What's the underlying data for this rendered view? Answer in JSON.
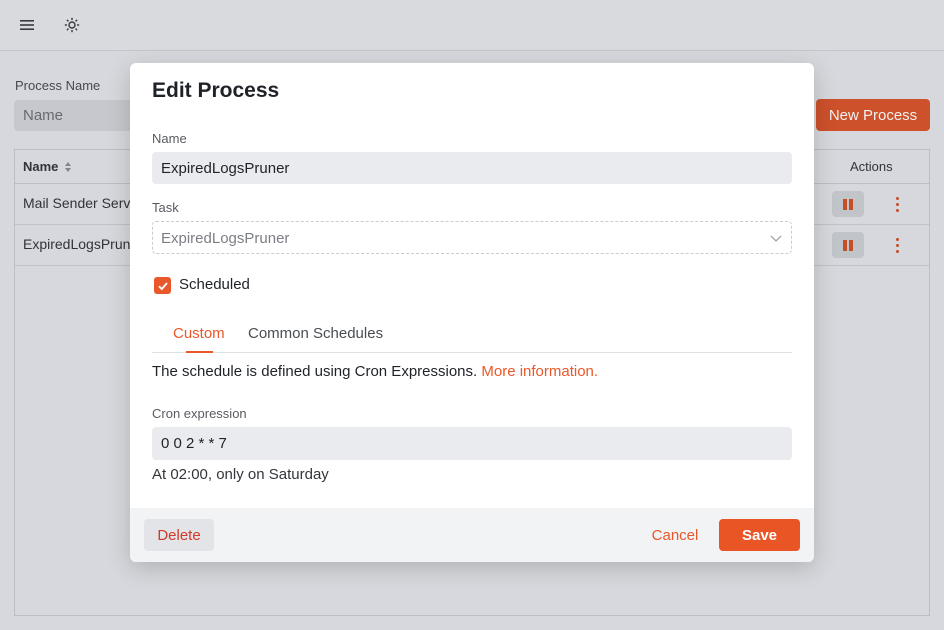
{
  "header": {
    "menu_icon": "hamburger-icon",
    "theme_icon": "sun-icon"
  },
  "filter": {
    "label": "Process Name",
    "placeholder": "Name"
  },
  "new_process_label": "New Process",
  "table": {
    "col_name": "Name",
    "col_actions": "Actions",
    "rows": [
      {
        "name": "Mail Sender Serv"
      },
      {
        "name": "ExpiredLogsPrun"
      }
    ]
  },
  "modal": {
    "title": "Edit Process",
    "name_label": "Name",
    "name_value": "ExpiredLogsPruner",
    "task_label": "Task",
    "task_value": "ExpiredLogsPruner",
    "scheduled_label": "Scheduled",
    "scheduled_checked": true,
    "tabs": [
      {
        "label": "Custom",
        "active": true
      },
      {
        "label": "Common Schedules",
        "active": false
      }
    ],
    "desc_text": "The schedule is defined using Cron Expressions. ",
    "desc_link": "More information.",
    "cron_label": "Cron expression",
    "cron_value": "0 0 2 * * 7",
    "cron_human": "At 02:00, only on Saturday",
    "delete_label": "Delete",
    "cancel_label": "Cancel",
    "save_label": "Save"
  },
  "colors": {
    "accent": "#e8582a",
    "danger": "#d0392b"
  }
}
